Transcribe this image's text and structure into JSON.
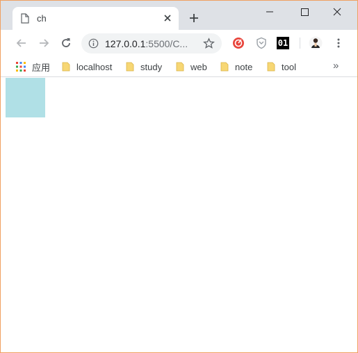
{
  "tab": {
    "title": "ch"
  },
  "omnibox": {
    "url_host": "127.0.0.1",
    "url_rest": ":5500/C..."
  },
  "extensions": {
    "badge_01": "01"
  },
  "bookmarks": {
    "apps_label": "应用",
    "items": [
      {
        "label": "localhost"
      },
      {
        "label": "study"
      },
      {
        "label": "web"
      },
      {
        "label": "note"
      },
      {
        "label": "tool"
      }
    ],
    "more": "»"
  },
  "page": {
    "box_color": "#b0e0e6"
  },
  "colors": {
    "tabstrip": "#dee1e6",
    "folder": "#f7d774",
    "window_border": "#f0a060"
  }
}
